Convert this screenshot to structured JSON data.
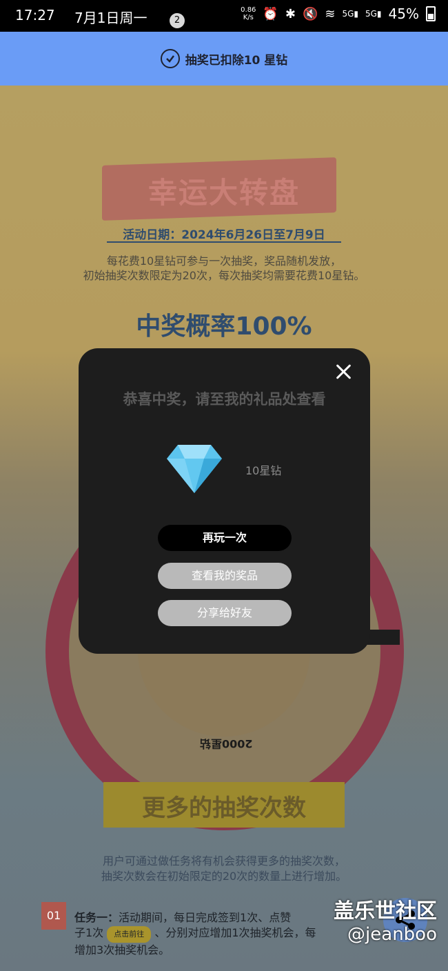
{
  "status_bar": {
    "time": "17:27",
    "date": "7月1日周一",
    "notification_count": "2",
    "net_speed_value": "0.86",
    "net_speed_unit": "K/s",
    "battery": "45%",
    "icons": [
      "alarm-icon",
      "bluetooth-icon",
      "mute-icon",
      "wifi-icon",
      "signal-5g-icon",
      "signal-5g-icon",
      "battery-icon"
    ]
  },
  "toast": {
    "text": "抽奖已扣除10 星钻"
  },
  "background": {
    "title": "幸运大转盘",
    "date_line": "活动日期：2024年6月26日至7月9日",
    "desc_line1": "每花费10星钻可参与一次抽奖，奖品随机发放，",
    "desc_line2": "初始抽奖次数限定为20次，每次抽奖均需要花费10星钻。",
    "probability": "中奖概率100%",
    "wheel_label": "2000星钻",
    "more_title": "更多的抽奖次数",
    "more_desc_line1": "用户可通过做任务将有机会获得更多的抽奖次数，",
    "more_desc_line2": "抽奖次数会在初始限定的20次的数量上进行增加。",
    "task_number": "01",
    "task_label": "任务一：",
    "task_text_a": "活动期间，每日完成签到1次、点赞",
    "task_text_b": "子1次",
    "task_go": "点击前往",
    "task_text_c": "、分别对应增加1次抽奖机会，每",
    "task_text_d": "增加3次抽奖机会。"
  },
  "watermark": {
    "line1": "盖乐世社区",
    "line2": "@jeanboo"
  },
  "modal": {
    "title": "恭喜中奖，请至我的礼品处查看",
    "prize_label": "10星钻",
    "play_again": "再玩一次",
    "view_prizes": "查看我的奖品",
    "share": "分享给好友"
  },
  "colors": {
    "toast_bg": "#6a9cf6",
    "modal_bg": "#1d1d1d",
    "primary_btn": "#000000",
    "secondary_btn": "#b9b9b9"
  }
}
